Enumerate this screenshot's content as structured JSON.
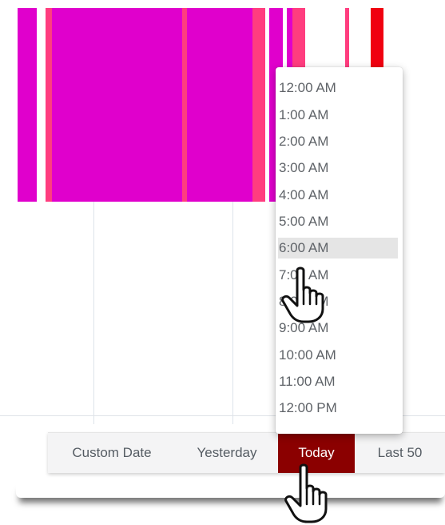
{
  "timeline": {
    "colors": {
      "magenta": "#e000cc",
      "pink": "#ff3d7f",
      "red": "#f00010"
    }
  },
  "time_dropdown": {
    "options": [
      "12:00 AM",
      "1:00 AM",
      "2:00 AM",
      "3:00 AM",
      "4:00 AM",
      "5:00 AM",
      "6:00 AM",
      "7:00 AM",
      "8:00 AM",
      "9:00 AM",
      "10:00 AM",
      "11:00 AM",
      "12:00 PM"
    ],
    "highlighted": "6:00 AM"
  },
  "range_buttons": {
    "custom_date": "Custom Date",
    "yesterday": "Yesterday",
    "today": "Today",
    "last_50": "Last 50",
    "active": "Today",
    "active_color": "#8b0000"
  },
  "cursors": {
    "dropdown_cursor": "hand-pointer-icon",
    "toolbar_cursor": "hand-pointer-icon"
  }
}
